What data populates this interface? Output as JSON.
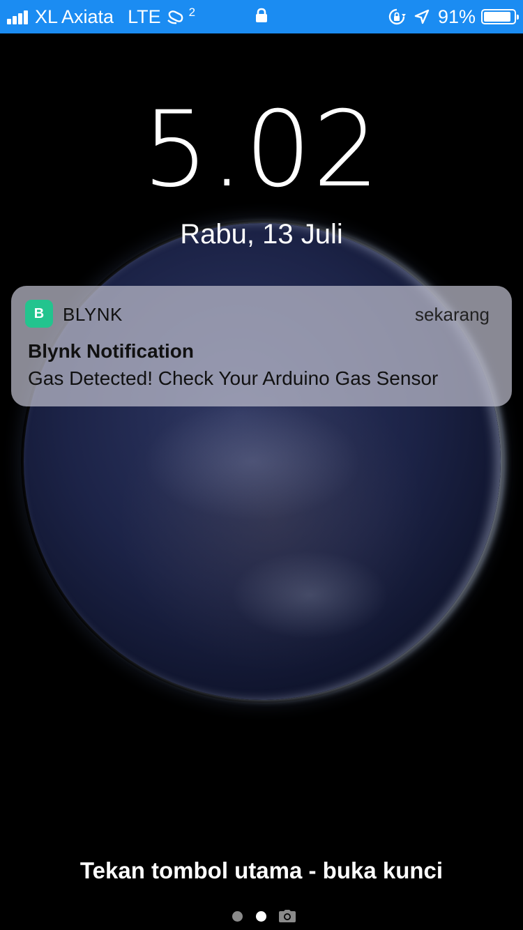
{
  "status_bar": {
    "carrier": "XL Axiata",
    "network": "LTE",
    "hotspot_count": "2",
    "battery_percent": "91%",
    "battery_level": 0.91,
    "background_color": "#1b8cf2",
    "icons": [
      "signal-icon",
      "hotspot-icon",
      "lock-icon",
      "rotation-lock-icon",
      "location-icon",
      "battery-icon"
    ]
  },
  "lock_screen": {
    "time": "5.02",
    "date": "Rabu, 13 Juli"
  },
  "notification": {
    "app_icon_letter": "B",
    "app_name": "BLYNK",
    "time": "sekarang",
    "title": "Blynk Notification",
    "body": "Gas Detected! Check Your Arduino Gas Sensor",
    "icon_color": "#23c48e"
  },
  "footer": {
    "unlock_hint": "Tekan tombol utama - buka kunci",
    "page_count": 2,
    "active_page": 2,
    "camera_icon": "camera-icon"
  }
}
